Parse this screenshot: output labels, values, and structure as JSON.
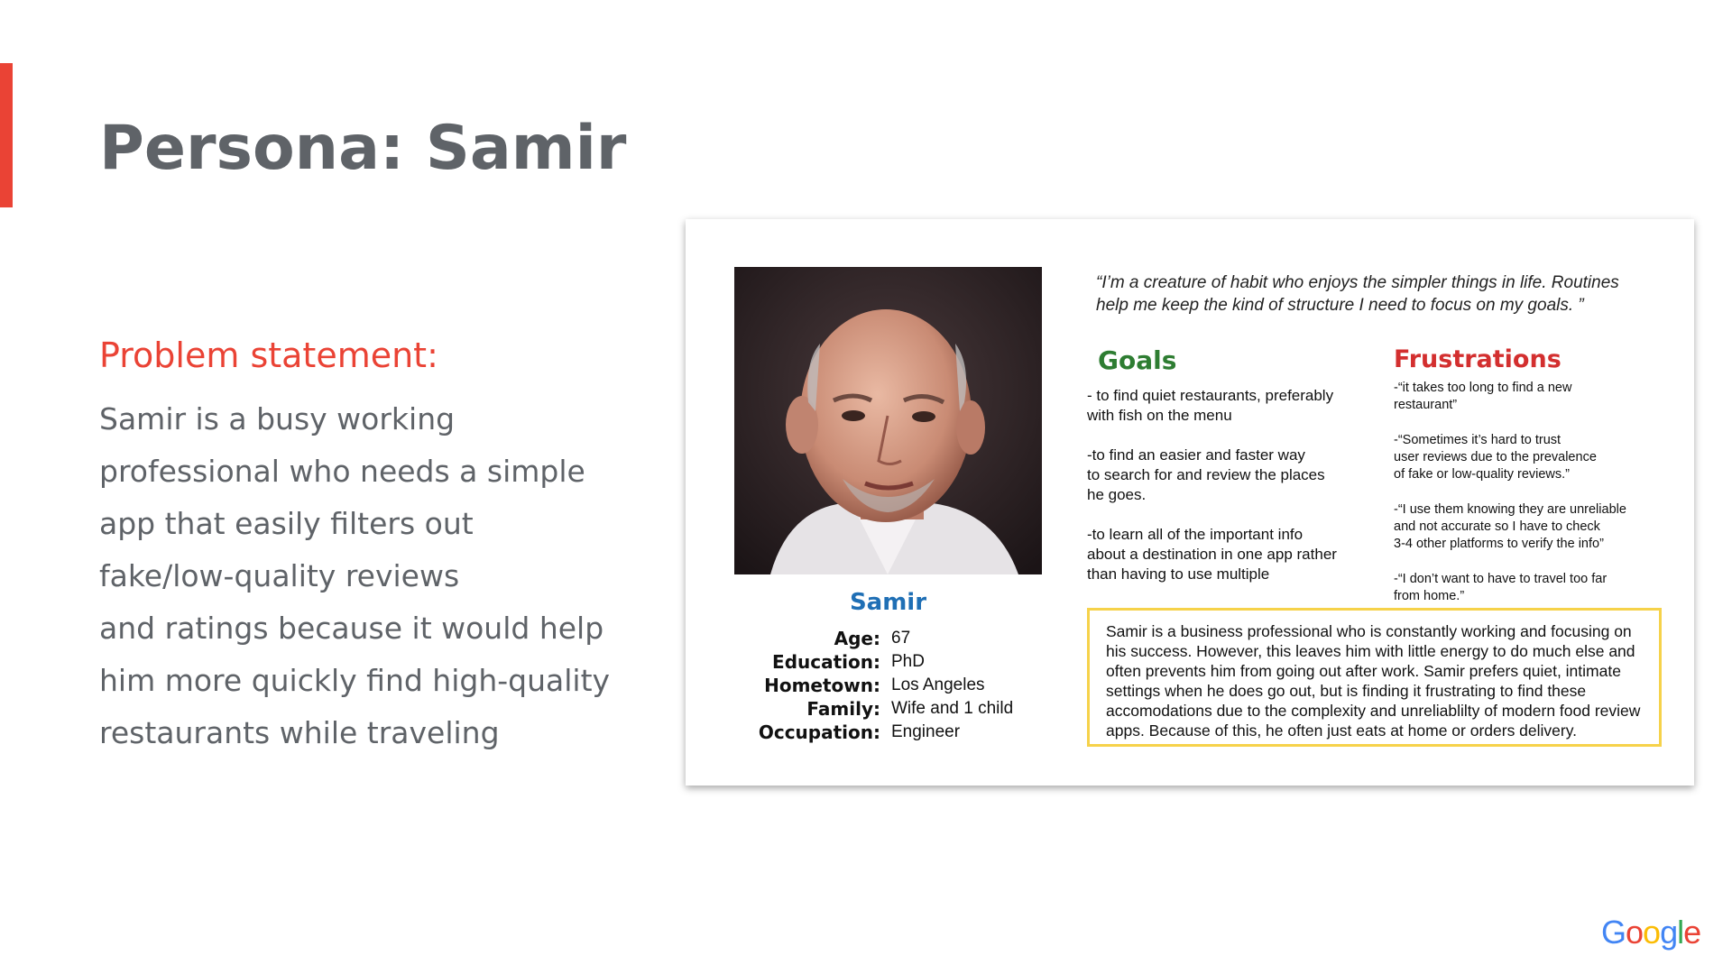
{
  "slide": {
    "title_prefix": "Persona: ",
    "title_name": "Samir",
    "accent_color": "#ea4335"
  },
  "problem": {
    "heading": "Problem statement:",
    "lines": [
      "Samir is a busy working",
      "professional who needs a simple",
      "app that easily filters out",
      "fake/low-quality reviews",
      "and ratings because it would help",
      "him more quickly find high-quality",
      "restaurants while traveling"
    ]
  },
  "persona": {
    "name": "Samir",
    "name_color": "#1f6fb5",
    "stats": [
      {
        "label": "Age:",
        "value": "67"
      },
      {
        "label": "Education:",
        "value": "PhD"
      },
      {
        "label": "Hometown:",
        "value": "Los Angeles"
      },
      {
        "label": "Family:",
        "value": "Wife and 1 child"
      },
      {
        "label": "Occupation:",
        "value": "Engineer"
      }
    ],
    "quote": "“I’m a creature of habit who enjoys the simpler things in life. Routines help me keep the kind of structure I need to focus on my goals. ”",
    "goals_title": "Goals",
    "goals_color": "#2e7d32",
    "goals": [
      "- to find quiet restaurants, preferably\n with fish on the menu",
      "-to find an easier and faster way\nto search for and review the places\nhe goes.",
      "-to learn all of the important info\nabout a destination in one app rather\nthan having to use multiple"
    ],
    "frustrations_title": "Frustrations",
    "frustrations_color": "#d32f2f",
    "frustrations": [
      "-“it takes too long to find a new\nrestaurant”",
      "-“Sometimes it’s hard to trust\nuser reviews due to the prevalence\nof fake or low-quality reviews.”",
      "-“I use them knowing they are unreliable\nand not accurate so I have to check\n3-4 other platforms  to verify the info”",
      "-“I don’t want to have to travel too far\nfrom home.”"
    ],
    "bio": "Samir is a business professional who is constantly working and focusing on his success. However, this leaves him with little energy to do much else and often prevents him from going out after work. Samir prefers quiet, intimate settings when he does go out, but is finding it frustrating to find these accomodations due to the complexity and unreliablilty of modern food review apps.  Because of this, he often just eats at home or orders delivery.",
    "bio_border_color": "#f6d24a"
  },
  "logo": {
    "text": "Google",
    "letter_colors": [
      "#4285f4",
      "#ea4335",
      "#fbbc05",
      "#4285f4",
      "#34a853",
      "#ea4335"
    ]
  }
}
